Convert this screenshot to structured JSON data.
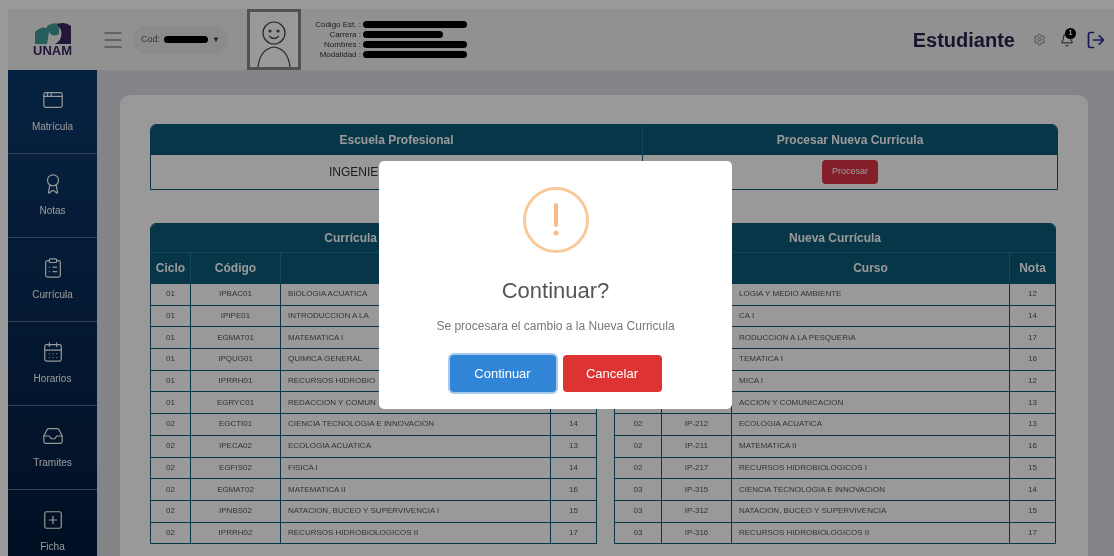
{
  "header": {
    "logo": "UNAM",
    "code_label": "Cod:",
    "code_caret": "▼",
    "info_labels": [
      "Codigo Est. :",
      "Carrera :",
      "Nombres :",
      "Modalidad :"
    ],
    "role": "Estudiante",
    "notification_count": "1"
  },
  "sidebar": {
    "items": [
      {
        "label": "Matrícula",
        "kind": "window",
        "selected": false
      },
      {
        "label": "Notas",
        "kind": "award",
        "selected": false
      },
      {
        "label": "Currícula",
        "kind": "clipboard",
        "selected": false
      },
      {
        "label": "Horarios",
        "kind": "calendar",
        "selected": false
      },
      {
        "label": "Tramites",
        "kind": "inbox",
        "selected": false
      },
      {
        "label": "Ficha",
        "kind": "plus",
        "selected": false
      }
    ]
  },
  "school_table": {
    "columns": [
      "Escuela Profesional",
      "Procesar Nueva Curricula"
    ],
    "school": "INGENIE",
    "process_button": "Procesar"
  },
  "tables": [
    {
      "title": "Currícula",
      "column_headers": {
        "ciclo": "Ciclo",
        "codigo": "Código"
      },
      "rows": [
        {
          "ciclo": "01",
          "codigo": "IPBAC01",
          "curso": "BIOLOGIA ACUATICA"
        },
        {
          "ciclo": "01",
          "codigo": "IPIPE01",
          "curso": "INTRODUCCION A LA"
        },
        {
          "ciclo": "01",
          "codigo": "EGMAT01",
          "curso": "MATEMATICA I"
        },
        {
          "ciclo": "01",
          "codigo": "IPQUG01",
          "curso": "QUIMICA GENERAL"
        },
        {
          "ciclo": "01",
          "codigo": "IPRRH01",
          "curso": "RECURSOS HIDROBIO"
        },
        {
          "ciclo": "01",
          "codigo": "EGRYC01",
          "curso": "REDACCION Y COMUN"
        },
        {
          "ciclo": "02",
          "codigo": "EGCTI01",
          "curso": "CIENCIA TECNOLOGIA E INNOVACION",
          "nota": "14"
        },
        {
          "ciclo": "02",
          "codigo": "IPECA02",
          "curso": "ECOLOGIA ACUATICA",
          "nota": "13"
        },
        {
          "ciclo": "02",
          "codigo": "EGFIS02",
          "curso": "FISICA I",
          "nota": "14"
        },
        {
          "ciclo": "02",
          "codigo": "EGMAT02",
          "curso": "MATEMATICA II",
          "nota": "16"
        },
        {
          "ciclo": "02",
          "codigo": "IPNBS02",
          "curso": "NATACION, BUCEO Y SUPERVIVENCIA I",
          "nota": "15"
        },
        {
          "ciclo": "02",
          "codigo": "IPRRH02",
          "curso": "RECURSOS HIDROBIOLOGICOS II",
          "nota": "17"
        }
      ]
    },
    {
      "title": "Nueva Currícula",
      "column_headers": {
        "curso": "Curso",
        "nota": "Nota"
      },
      "rows": [
        {
          "curso": "LOGIA Y MEDIO AMBIENTE",
          "nota": "12"
        },
        {
          "curso": "CA I",
          "nota": "14"
        },
        {
          "curso": "RODUCCION A LA PESQUERIA",
          "nota": "17"
        },
        {
          "curso": "TEMATICA I",
          "nota": "16"
        },
        {
          "curso": "MICA I",
          "nota": "12"
        },
        {
          "curso": "ACCION Y COMUNICACION",
          "nota": "13"
        },
        {
          "ciclo": "02",
          "codigo": "IP-212",
          "curso": "ECOLOGIA ACUATICA",
          "nota": "13"
        },
        {
          "ciclo": "02",
          "codigo": "IP-211",
          "curso": "MATEMATICA II",
          "nota": "16"
        },
        {
          "ciclo": "02",
          "codigo": "IP-217",
          "curso": "RECURSOS HIDROBIOLOGICOS I",
          "nota": "15"
        },
        {
          "ciclo": "03",
          "codigo": "IP-315",
          "curso": "CIENCIA TECNOLOGIA E INNOVACION",
          "nota": "14"
        },
        {
          "ciclo": "03",
          "codigo": "IP-312",
          "curso": "NATACION, BUCEO Y SUPERVIVENCIA",
          "nota": "15"
        },
        {
          "ciclo": "03",
          "codigo": "IP-316",
          "curso": "RECURSOS HIDROBIOLOGICOS II",
          "nota": "17"
        }
      ]
    }
  ],
  "dialog": {
    "title": "Continuar?",
    "message": "Se procesara el cambio a la Nueva Curricula",
    "buttons": [
      {
        "label": "Continuar",
        "kind": "confirm"
      },
      {
        "label": "Cancelar",
        "kind": "cancel"
      }
    ]
  }
}
